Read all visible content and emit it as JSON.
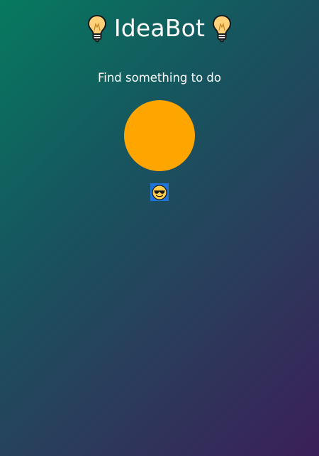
{
  "header": {
    "title": "IdeaBot",
    "left_icon": "lightbulb-icon",
    "right_icon": "lightbulb-icon"
  },
  "subtitle": "Find something to do",
  "action_button": {
    "color": "#ffa500"
  },
  "status_emoji": {
    "icon": "smiling-face-with-sunglasses-icon",
    "background": "#1f73d6"
  },
  "colors": {
    "gradient_start": "#067a5f",
    "gradient_end": "#3b1f58"
  }
}
